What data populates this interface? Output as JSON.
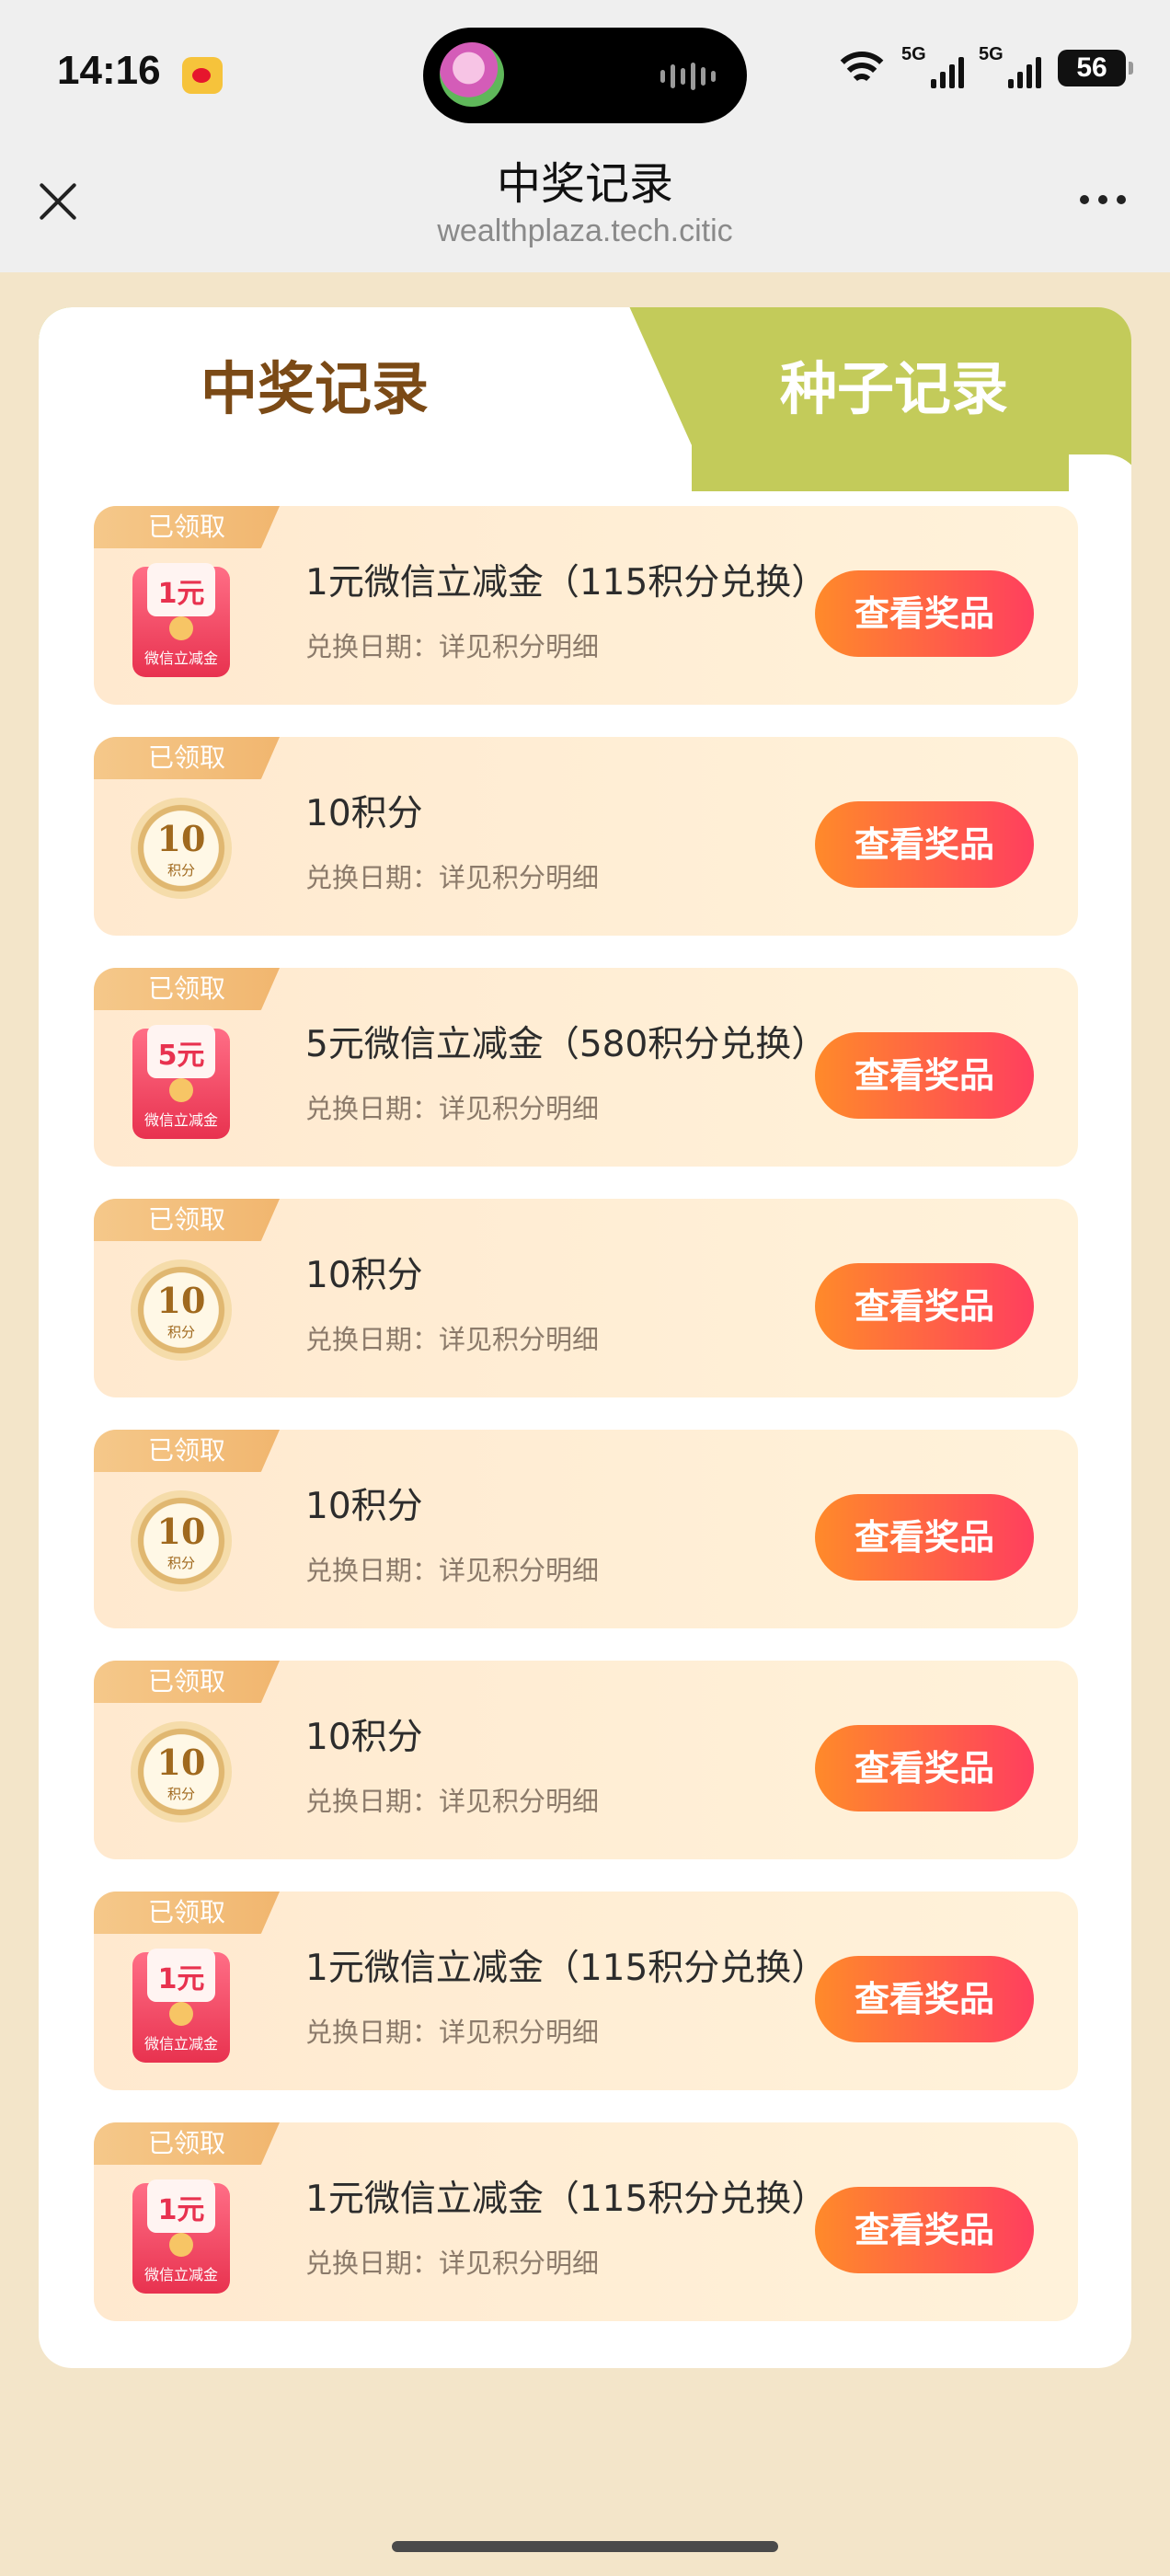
{
  "status_bar": {
    "time": "14:16",
    "network_1": "5G",
    "network_2": "5G",
    "battery": "56"
  },
  "nav": {
    "title": "中奖记录",
    "subtitle": "wealthplaza.tech.citic"
  },
  "tabs": [
    {
      "label": "中奖记录",
      "active": true
    },
    {
      "label": "种子记录",
      "active": false
    }
  ],
  "records": [
    {
      "status": "已领取",
      "icon": "red-envelope-icon",
      "icon_amount": "1元",
      "icon_label": "微信立减金",
      "title": "1元微信立减金（115积分兑换）",
      "date": "兑换日期：详见积分明细",
      "button": "查看奖品"
    },
    {
      "status": "已领取",
      "icon": "points-coin-icon",
      "icon_amount": "10",
      "icon_label": "积分",
      "title": "10积分",
      "date": "兑换日期：详见积分明细",
      "button": "查看奖品"
    },
    {
      "status": "已领取",
      "icon": "red-envelope-icon",
      "icon_amount": "5元",
      "icon_label": "微信立减金",
      "title": "5元微信立减金（580积分兑换）",
      "date": "兑换日期：详见积分明细",
      "button": "查看奖品"
    },
    {
      "status": "已领取",
      "icon": "points-coin-icon",
      "icon_amount": "10",
      "icon_label": "积分",
      "title": "10积分",
      "date": "兑换日期：详见积分明细",
      "button": "查看奖品"
    },
    {
      "status": "已领取",
      "icon": "points-coin-icon",
      "icon_amount": "10",
      "icon_label": "积分",
      "title": "10积分",
      "date": "兑换日期：详见积分明细",
      "button": "查看奖品"
    },
    {
      "status": "已领取",
      "icon": "points-coin-icon",
      "icon_amount": "10",
      "icon_label": "积分",
      "title": "10积分",
      "date": "兑换日期：详见积分明细",
      "button": "查看奖品"
    },
    {
      "status": "已领取",
      "icon": "red-envelope-icon",
      "icon_amount": "1元",
      "icon_label": "微信立减金",
      "title": "1元微信立减金（115积分兑换）",
      "date": "兑换日期：详见积分明细",
      "button": "查看奖品"
    },
    {
      "status": "已领取",
      "icon": "red-envelope-icon",
      "icon_amount": "1元",
      "icon_label": "微信立减金",
      "title": "1元微信立减金（115积分兑换）",
      "date": "兑换日期：详见积分明细",
      "button": "查看奖品"
    }
  ],
  "colors": {
    "page_bg": "#f3e5c9",
    "tab_inactive": "#c3cb5a",
    "tab_active_text": "#7b4a16",
    "button_start": "#ff8a2a",
    "button_end": "#ff3f5e"
  }
}
